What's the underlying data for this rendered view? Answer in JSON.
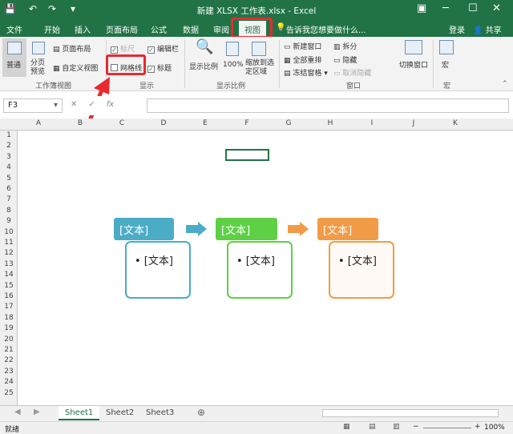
{
  "window": {
    "title": "新建 XLSX 工作表.xlsx - Excel",
    "save_icon": "save-icon",
    "undo_icon": "undo-icon",
    "redo_icon": "redo-icon"
  },
  "tabs": [
    "文件",
    "开始",
    "插入",
    "页面布局",
    "公式",
    "数据",
    "审阅",
    "视图"
  ],
  "tell_me": "告诉我您想要做什么...",
  "login": "登录",
  "share": "共享",
  "ribbon": {
    "view_group": {
      "normal": "普通",
      "page_break": "分页预览",
      "page_layout": "页面布局",
      "custom_view": "自定义视图",
      "label": "工作簿视图"
    },
    "show_group": {
      "ruler": "标尺",
      "gridlines": "网格线",
      "formula_bar": "编辑栏",
      "headings": "标题",
      "label": "显示"
    },
    "zoom_group": {
      "zoom": "显示比例",
      "hundred": "100%",
      "zoom_sel": "缩放到选定区域",
      "label": "显示比例"
    },
    "window_group": {
      "new_window": "新建窗口",
      "arrange": "全部重排",
      "freeze": "冻结窗格",
      "split": "拆分",
      "hide": "隐藏",
      "unhide": "取消隐藏",
      "switch": "切换窗口",
      "label": "窗口"
    },
    "macro_group": {
      "macro": "宏",
      "label": "宏"
    }
  },
  "namebox": "F3",
  "fx": "fx",
  "columns": [
    "A",
    "B",
    "C",
    "D",
    "E",
    "F",
    "G",
    "H",
    "I",
    "J",
    "K"
  ],
  "rows": [
    "1",
    "2",
    "3",
    "4",
    "5",
    "6",
    "7",
    "8",
    "9",
    "10",
    "11",
    "12",
    "13",
    "14",
    "15",
    "16",
    "17",
    "18",
    "19",
    "20",
    "21",
    "22",
    "23",
    "24",
    "25"
  ],
  "smartart": [
    {
      "header": "[文本]",
      "bullet": "• [文本]",
      "color": "#4bacc6"
    },
    {
      "header": "[文本]",
      "bullet": "• [文本]",
      "color": "#5ed045"
    },
    {
      "header": "[文本]",
      "bullet": "• [文本]",
      "color": "#f29b46"
    }
  ],
  "sheets": [
    "Sheet1",
    "Sheet2",
    "Sheet3"
  ],
  "status": {
    "ready": "就绪",
    "zoom": "100%"
  }
}
